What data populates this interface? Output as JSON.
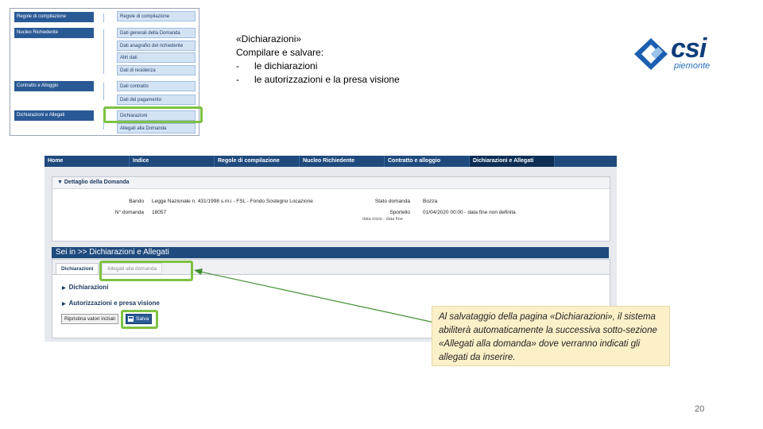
{
  "nav_tree": {
    "left_items": [
      {
        "label": "Regole di compilazione"
      },
      {
        "label": "Nucleo Richiedente"
      },
      {
        "label": "Contratto e Alloggio"
      },
      {
        "label": "Dichiarazioni e Allegati"
      }
    ],
    "right_items": [
      {
        "label": "Regole di compilazione"
      },
      {
        "label": "Dati generali della Domanda"
      },
      {
        "label": "Dati anagrafici del richiedente"
      },
      {
        "label": "Altri dati"
      },
      {
        "label": "Dati di residenza"
      },
      {
        "label": "Dati contratto"
      },
      {
        "label": "Dati del pagamento"
      },
      {
        "label": "Dichiarazioni"
      },
      {
        "label": "Allegati alla Domanda"
      }
    ]
  },
  "instructions": {
    "title": "«Dichiarazioni»",
    "subtitle": "Compilare e salvare:",
    "bullet_marker": "-",
    "items": [
      "le dichiarazioni",
      "le autorizzazioni e la presa visione"
    ]
  },
  "logo": {
    "word": "csi",
    "sub": "piemonte"
  },
  "app": {
    "nav": [
      {
        "label": "Home"
      },
      {
        "label": "Indice"
      },
      {
        "label": "Regole di compilazione"
      },
      {
        "label": "Nucleo Richiedente"
      },
      {
        "label": "Contratto e alloggio"
      },
      {
        "label": "Dichiarazioni e Allegati"
      }
    ],
    "detail": {
      "header": "▼ Dettaglio della Domanda",
      "bando_label": "Bando",
      "bando_value": "Legge Nazionale n. 431/1998 s.m.i - FSL - Fondo Sostegno Locazione",
      "numero_label": "N° domanda",
      "numero_value": "18057",
      "stato_label": "Stato domanda",
      "stato_value": "Bozza",
      "sportello_label": "Sportello",
      "sportello_value": "01/04/2020 00:00 - data fine non definita",
      "sportello_sub": "data inizio - data fine"
    },
    "breadcrumb": "Sei in >> Dichiarazioni e Allegati",
    "tabs": [
      {
        "label": "Dichiarazioni"
      },
      {
        "label": "Allegati alla domanda"
      }
    ],
    "sections": [
      "Dichiarazioni",
      "Autorizzazioni e presa visione"
    ],
    "buttons": {
      "reset": "Ripristina valori iniziali",
      "save": "Salva"
    }
  },
  "callout": "Al salvataggio della pagina «Dichiarazioni», il sistema abiliterà automaticamente la successiva sotto-sezione «Allegati alla domanda» dove verranno indicati gli allegati da inserire.",
  "page_number": "20",
  "colors": {
    "highlight": "#7dc242",
    "nav_bg": "#1f4a7d",
    "callout_bg": "#fcf0c8",
    "logo_blue": "#0f3d7a"
  }
}
